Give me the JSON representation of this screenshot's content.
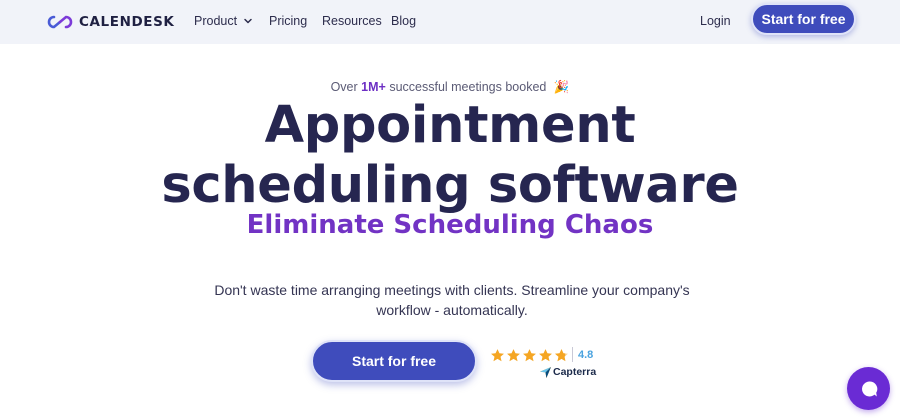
{
  "nav": {
    "logo_text": "CALENDESK",
    "items": [
      {
        "label": "Product"
      },
      {
        "label": "Pricing"
      },
      {
        "label": "Resources"
      },
      {
        "label": "Blog"
      }
    ],
    "login_label": "Login",
    "cta_label": "Start for free"
  },
  "hero": {
    "tagline_prefix": "Over",
    "tagline_strong": "1M+",
    "tagline_suffix": "successful meetings booked",
    "tagline_emoji": "🎉",
    "title_line1": "Appointment",
    "title_line2": "scheduling software",
    "subtitle": "Eliminate Scheduling Chaos",
    "description": "Don't waste time arranging meetings with clients. Streamline your company's workflow - automatically.",
    "cta_label": "Start for free"
  },
  "rating": {
    "value": "4.8",
    "stars": 4.8,
    "source": "Capterra"
  },
  "colors": {
    "primary": "#3f4cbc",
    "accent": "#7233c4",
    "heading": "#262650",
    "star": "#f5a623",
    "chat": "#6a2bd4"
  }
}
